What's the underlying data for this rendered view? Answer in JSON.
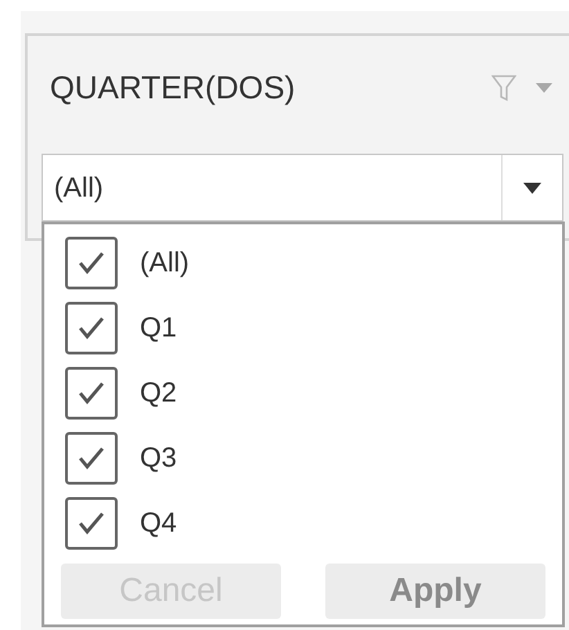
{
  "filter": {
    "title": "QUARTER(DOS)",
    "value": "(All)"
  },
  "options": [
    {
      "label": "(All)",
      "checked": true
    },
    {
      "label": "Q1",
      "checked": true
    },
    {
      "label": "Q2",
      "checked": true
    },
    {
      "label": "Q3",
      "checked": true
    },
    {
      "label": "Q4",
      "checked": true
    }
  ],
  "buttons": [
    {
      "label": "Cancel",
      "disabled": true
    },
    {
      "label": "Apply",
      "disabled": false
    }
  ]
}
